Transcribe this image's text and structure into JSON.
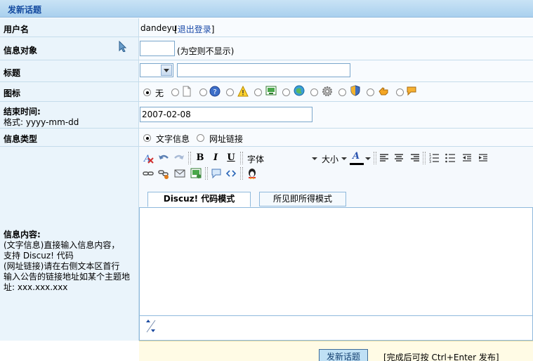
{
  "header": {
    "title": "发新话题"
  },
  "username": {
    "label": "用户名",
    "value": "dandeyu",
    "logout_open": "[",
    "logout": "退出登录",
    "logout_close": "]"
  },
  "recipient": {
    "label": "信息对象",
    "hint": "(为空则不显示)",
    "value": ""
  },
  "subject": {
    "label": "标题",
    "value": ""
  },
  "icon": {
    "label": "图标",
    "none_label": "无"
  },
  "end_time": {
    "label": "结束时间:",
    "format": "格式: yyyy-mm-dd",
    "value": "2007-02-08"
  },
  "info_type": {
    "label": "信息类型",
    "options": [
      "文字信息",
      "网址链接"
    ],
    "selected": 0
  },
  "content": {
    "label": "信息内容:",
    "lines": [
      "(文字信息)直接输入信息内容，",
      "支持 Discuz! 代码",
      "(网址链接)请在右侧文本区首行",
      "输入公告的链接地址如某个主题地",
      "址: xxx.xxx.xxx"
    ]
  },
  "toolbar": {
    "font": "字体",
    "size": "大小",
    "bold": "B",
    "italic": "I",
    "underline": "U",
    "font_color": "A"
  },
  "tabs": [
    "Discuz! 代码模式",
    "所见即所得模式"
  ],
  "submit": {
    "label": "发新话题",
    "hint": "[完成后可按 Ctrl+Enter 发布]"
  }
}
